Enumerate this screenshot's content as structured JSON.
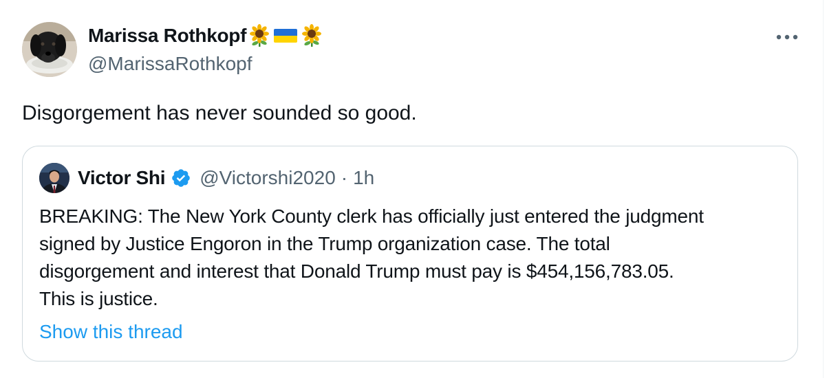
{
  "tweet": {
    "author_name": "Marissa Rothkopf",
    "author_emojis": [
      "sunflower-emoji",
      "ukraine-flag-emoji",
      "sunflower-emoji"
    ],
    "handle": "@MarissaRothkopf",
    "text": "Disgorgement has never sounded so good.",
    "more_icon": "more-horizontal-icon"
  },
  "quoted": {
    "author_name": "Victor Shi",
    "verified_icon": "verified-badge-icon",
    "handle": "@Victorshi2020",
    "separator": "·",
    "time": "1h",
    "text_lines": [
      "BREAKING: The New York County clerk has officially just entered the judgment",
      "signed by Justice Engoron in the Trump organization case. The total",
      "disgorgement and interest that Donald Trump must pay is $454,156,783.05.",
      "This is justice."
    ],
    "show_thread": "Show this thread"
  },
  "colors": {
    "text_primary": "#0f1419",
    "text_secondary": "#536471",
    "link": "#1d9bf0",
    "border": "#cfd9de"
  }
}
